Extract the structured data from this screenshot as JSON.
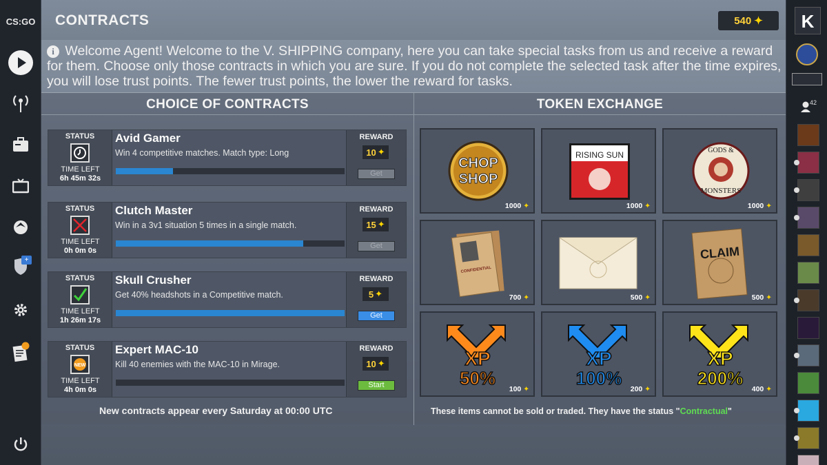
{
  "app": {
    "logo_text": "CS:GO",
    "title": "CONTRACTS"
  },
  "currency": {
    "amount": "540",
    "icon": "star-icon",
    "accent": "#ffd500"
  },
  "welcome": {
    "text": "Welcome Agent! Welcome to the V. SHIPPING company, here you can take special tasks from us and receive a reward for them. Choose only those contracts in which you are sure. If you do not complete the selected task after the time expires, you will lose trust points. The fewer trust points, the lower the reward for tasks."
  },
  "contracts_section": {
    "title": "CHOICE OF CONTRACTS",
    "footer": "New contracts appear every Saturday at 00:00 UTC",
    "status_label": "STATUS",
    "time_label": "TIME LEFT",
    "reward_label": "REWARD",
    "items": [
      {
        "name": "Avid Gamer",
        "description": "Win 4 competitive matches. Match type: Long",
        "time_left": "6h 45m 32s",
        "reward": "10",
        "button": "Get",
        "button_state": "disabled",
        "status": "clock",
        "progress": 0.25
      },
      {
        "name": "Clutch Master",
        "description": "Win in a 3v1 situation 5 times in a single match.",
        "time_left": "0h 0m 0s",
        "reward": "15",
        "button": "Get",
        "button_state": "disabled",
        "status": "failed",
        "progress": 0.82
      },
      {
        "name": "Skull Crusher",
        "description": "Get 40% headshots in a Competitive match.",
        "time_left": "1h 26m 17s",
        "reward": "5",
        "button": "Get",
        "button_state": "active",
        "status": "completed",
        "progress": 1.0
      },
      {
        "name": "Expert MAC-10",
        "description": "Kill 40 enemies with the MAC-10 in Mirage.",
        "time_left": "4h 0m 0s",
        "reward": "10",
        "button": "Start",
        "button_state": "start",
        "status": "new",
        "progress": 0.0
      }
    ]
  },
  "exchange_section": {
    "title": "TOKEN EXCHANGE",
    "footer_prefix": "These items cannot be sold or traded. They have the status \"",
    "footer_status": "Contractual",
    "footer_suffix": "\"",
    "items": [
      {
        "icon": "chop-shop-patch-icon",
        "art": [
          "CHOP",
          "SHOP"
        ],
        "price": "1000"
      },
      {
        "icon": "rising-sun-patch-icon",
        "art": [
          "RISING SUN"
        ],
        "price": "1000"
      },
      {
        "icon": "gods-and-monsters-patch-icon",
        "art": [
          "GODS &",
          "MONSTERS"
        ],
        "price": "1000"
      },
      {
        "icon": "dossier-folder-icon",
        "art": [
          "CONFIDENTIAL"
        ],
        "price": "700"
      },
      {
        "icon": "envelope-icon",
        "art": [],
        "price": "500"
      },
      {
        "icon": "claim-envelope-icon",
        "art": [
          "CLAIM"
        ],
        "price": "500"
      },
      {
        "icon": "xp-boost-orange-icon",
        "art": [
          "XP",
          "50%"
        ],
        "price": "100",
        "color": "#ff8a1c"
      },
      {
        "icon": "xp-boost-blue-icon",
        "art": [
          "XP",
          "100%"
        ],
        "price": "200",
        "color": "#1e8cf0"
      },
      {
        "icon": "xp-boost-yellow-icon",
        "art": [
          "XP",
          "200%"
        ],
        "price": "400",
        "color": "#ffe41a"
      }
    ]
  },
  "friends": {
    "count": "42"
  }
}
